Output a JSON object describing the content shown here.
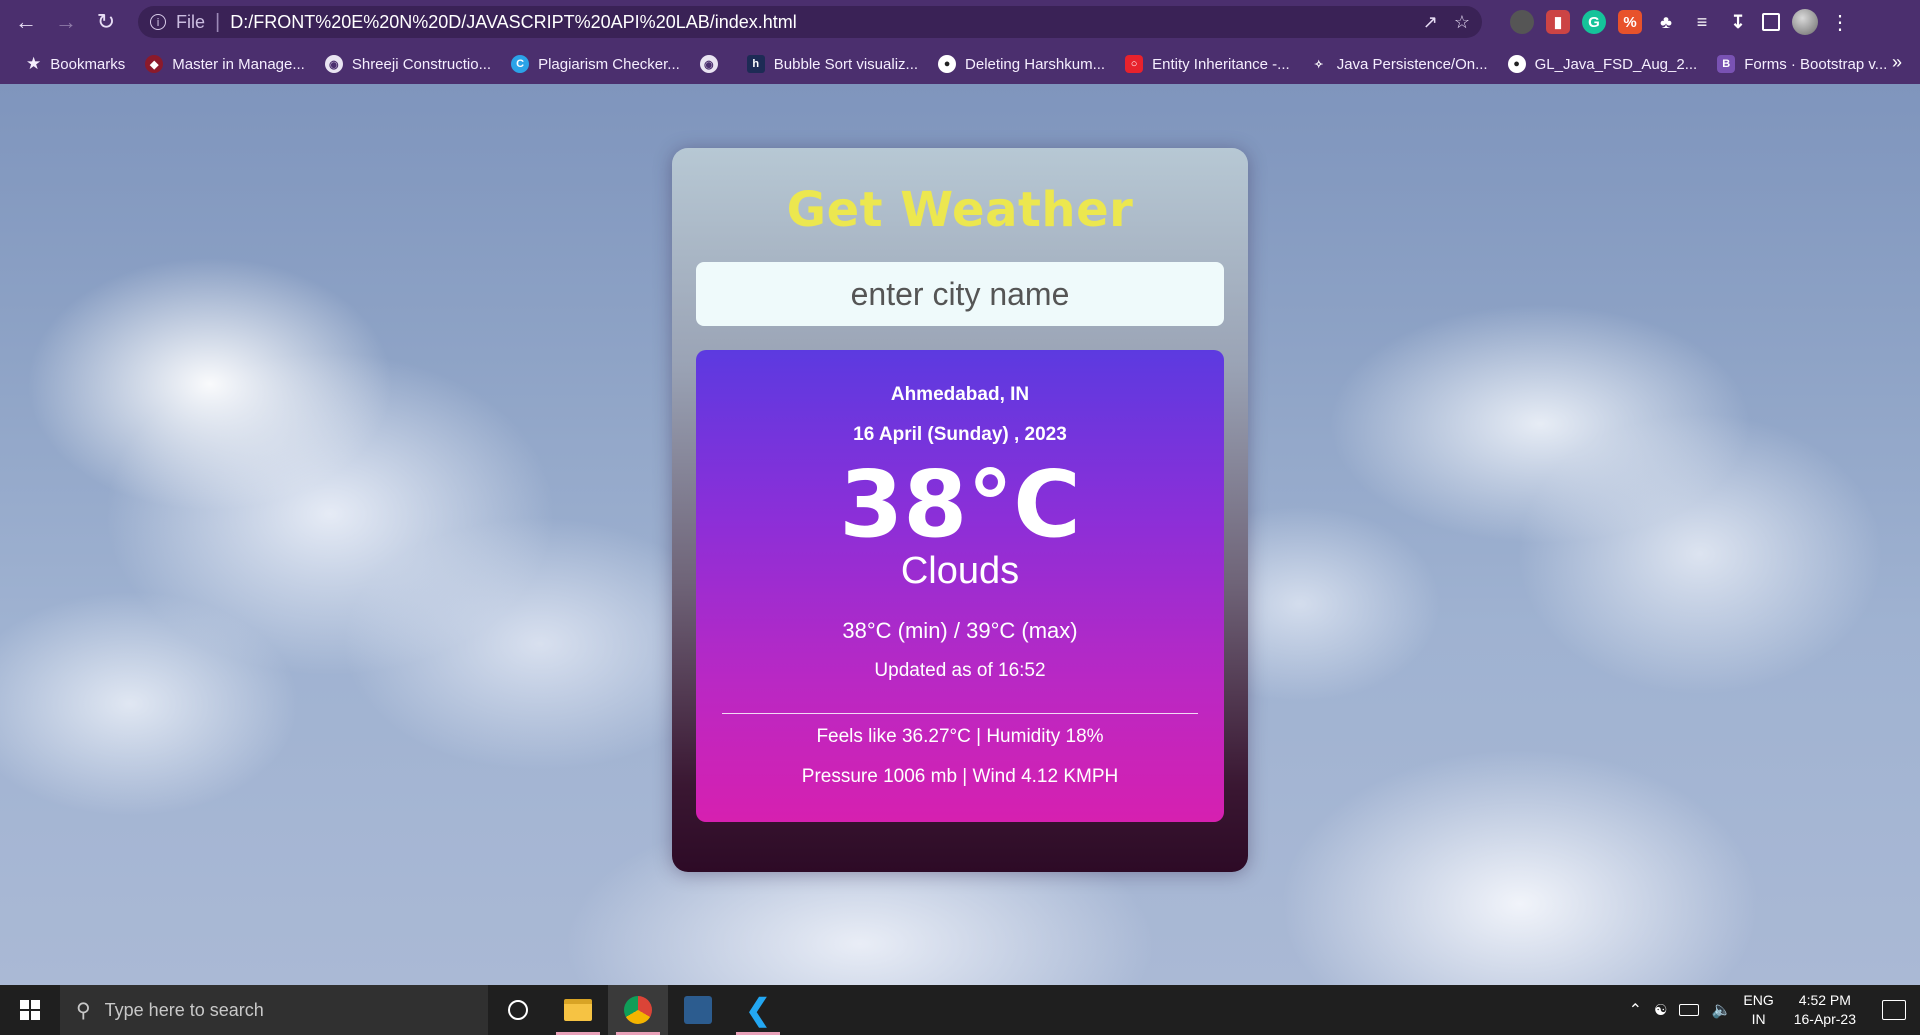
{
  "browser": {
    "url_scheme": "File",
    "url": "D:/FRONT%20E%20N%20D/JAVASCRIPT%20API%20LAB/index.html",
    "bookmarks": [
      {
        "label": "Bookmarks",
        "icon": "star-icon"
      },
      {
        "label": "Master in Manage...",
        "icon": "site-icon"
      },
      {
        "label": "Shreeji Constructio...",
        "icon": "globe-icon"
      },
      {
        "label": "Plagiarism Checker...",
        "icon": "site-icon"
      },
      {
        "label": "",
        "icon": "globe-icon"
      },
      {
        "label": "Bubble Sort visualiz...",
        "icon": "site-icon"
      },
      {
        "label": "Deleting Harshkum...",
        "icon": "github-icon"
      },
      {
        "label": "Entity Inheritance -...",
        "icon": "oracle-icon"
      },
      {
        "label": "Java Persistence/On...",
        "icon": "site-icon"
      },
      {
        "label": "GL_Java_FSD_Aug_2...",
        "icon": "github-icon"
      },
      {
        "label": "Forms · Bootstrap v...",
        "icon": "bootstrap-icon"
      }
    ],
    "more_label": "»"
  },
  "app": {
    "title": "Get Weather",
    "search_placeholder": "enter city name",
    "location": "Ahmedabad, IN",
    "date": "16 April (Sunday) , 2023",
    "temperature": "38°C",
    "condition": "Clouds",
    "min_max": "38°C (min) / 39°C (max)",
    "updated": "Updated as of 16:52",
    "feels_humidity": "Feels like 36.27°C | Humidity 18%",
    "pressure_wind": "Pressure 1006 mb | Wind 4.12 KMPH"
  },
  "colors": {
    "title_yellow": "#ece74f",
    "panel_top": "#5c3ae0",
    "panel_bottom": "#d620b0",
    "chrome_purple": "#4b2f6e"
  },
  "taskbar": {
    "search_placeholder": "Type here to search",
    "language_top": "ENG",
    "language_bottom": "IN",
    "time": "4:52 PM",
    "date": "16-Apr-23"
  }
}
